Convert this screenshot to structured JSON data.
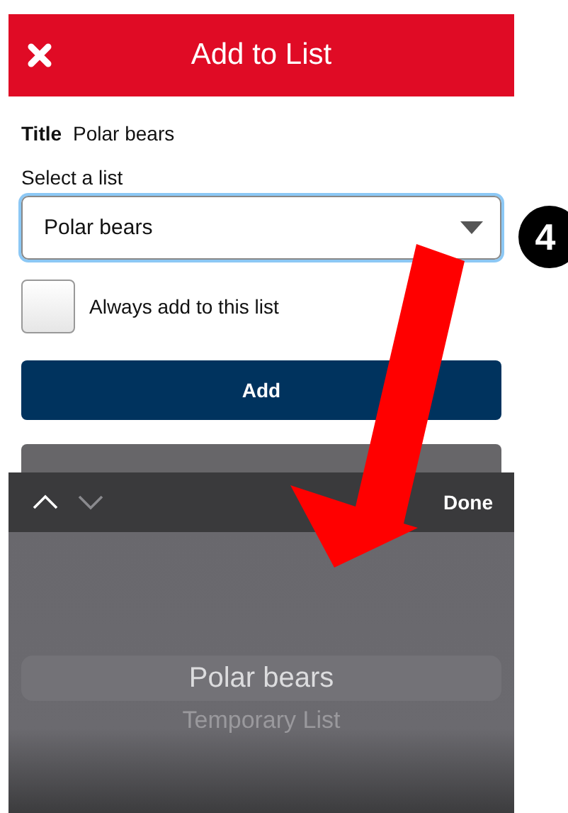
{
  "header": {
    "title": "Add to List"
  },
  "form": {
    "title_label": "Title",
    "title_value": "Polar bears",
    "select_label": "Select a list",
    "select_value": "Polar bears",
    "always_add": {
      "label": "Always add to this list",
      "checked": false
    },
    "add_button": "Add"
  },
  "step_badge": "4",
  "picker": {
    "nav": [
      {
        "kind": "up",
        "disabled": false
      },
      {
        "kind": "down",
        "disabled": true
      }
    ],
    "done": "Done",
    "options": [
      {
        "label": "Polar bears",
        "selected": true
      },
      {
        "label": "Temporary List",
        "selected": false
      }
    ]
  }
}
